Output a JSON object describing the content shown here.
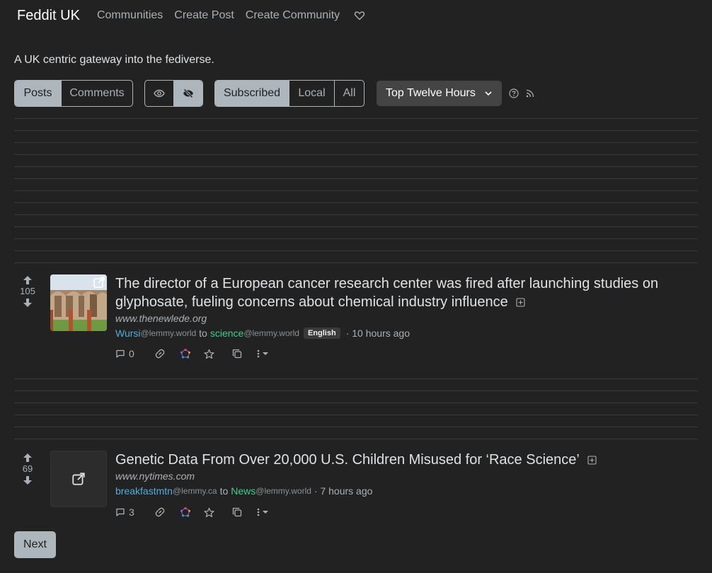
{
  "nav": {
    "brand": "Feddit UK",
    "links": [
      "Communities",
      "Create Post",
      "Create Community"
    ]
  },
  "tagline": "A UK centric gateway into the fediverse.",
  "filters": {
    "type": [
      "Posts",
      "Comments"
    ],
    "listing": [
      "Subscribed",
      "Local",
      "All"
    ],
    "sort": "Top Twelve Hours"
  },
  "posts": [
    {
      "score": "105",
      "title": "The director of a European cancer research center was fired after launching studies on glyphosate, fueling concerns about chemical industry influence",
      "domain": "www.thenewlede.org",
      "user": "Wursi",
      "user_instance": "@lemmy.world",
      "to": "to",
      "community": "science",
      "community_instance": "@lemmy.world",
      "language": "English",
      "time": "· 10 hours ago",
      "comments": "0"
    },
    {
      "score": "69",
      "title": "Genetic Data From Over 20,000 U.S. Children Misused for ‘Race Science’",
      "domain": "www.nytimes.com",
      "user": "breakfastmtn",
      "user_instance": "@lemmy.ca",
      "to": "to",
      "community": "News",
      "community_instance": "@lemmy.world",
      "time": "· 7 hours ago",
      "comments": "3"
    }
  ],
  "pagination": {
    "next": "Next"
  },
  "colors": {
    "background": "#222222",
    "user_link": "#4eaee0",
    "community_link": "#3ed08a",
    "active_button": "#adb5bd"
  }
}
